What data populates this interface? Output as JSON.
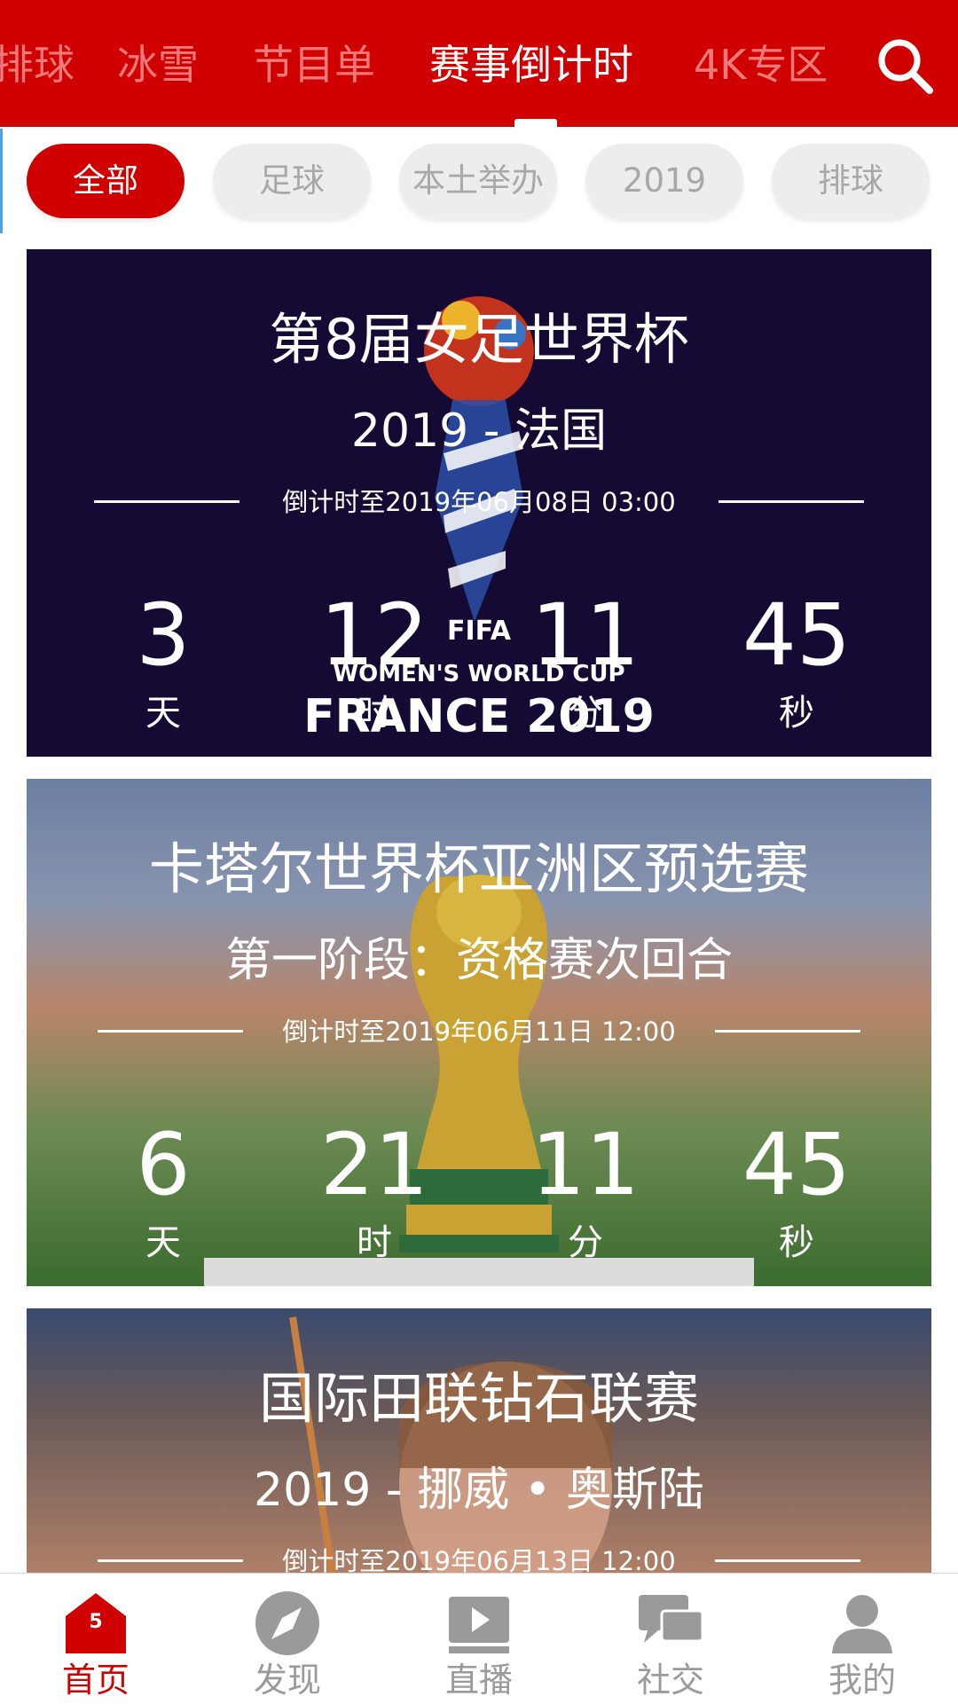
{
  "colors": {
    "brand": "#d10000",
    "inactive_tab": "#f07a7a",
    "chip_bg": "#ededed",
    "chip_text": "#a8a8a8",
    "bottom_inactive": "#9a9a9a"
  },
  "top_tabs": [
    {
      "label": "排球"
    },
    {
      "label": "冰雪"
    },
    {
      "label": "节目单"
    },
    {
      "label": "赛事倒计时",
      "active": true
    },
    {
      "label": "4K专区"
    }
  ],
  "search_icon": "search-icon",
  "filters": [
    {
      "label": "全部",
      "active": true
    },
    {
      "label": "足球"
    },
    {
      "label": "本土举办"
    },
    {
      "label": "2019"
    },
    {
      "label": "排球"
    }
  ],
  "events": [
    {
      "title": "第8届女足世界杯",
      "subtitle": "2019 - 法国",
      "countdown_to": "倒计时至2019年06月08日 03:00",
      "days": "3",
      "hours": "12",
      "minutes": "11",
      "seconds": "45",
      "poster_text_1": "FIFA",
      "poster_text_2": "WOMEN'S WORLD CUP",
      "poster_text_3": "FRANCE 2019"
    },
    {
      "title": "卡塔尔世界杯亚洲区预选赛",
      "subtitle": "第一阶段：资格赛次回合",
      "countdown_to": "倒计时至2019年06月11日 12:00",
      "days": "6",
      "hours": "21",
      "minutes": "11",
      "seconds": "45"
    },
    {
      "title": "国际田联钻石联赛",
      "subtitle": "2019 - 挪威 • 奥斯陆",
      "countdown_to": "倒计时至2019年06月13日 12:00"
    }
  ],
  "units": {
    "day": "天",
    "hour": "时",
    "minute": "分",
    "second": "秒"
  },
  "bottom_tabs": [
    {
      "label": "首页",
      "icon": "home-icon",
      "badge": "5",
      "active": true
    },
    {
      "label": "发现",
      "icon": "compass-icon"
    },
    {
      "label": "直播",
      "icon": "live-play-icon"
    },
    {
      "label": "社交",
      "icon": "chat-bubbles-icon"
    },
    {
      "label": "我的",
      "icon": "user-icon"
    }
  ]
}
